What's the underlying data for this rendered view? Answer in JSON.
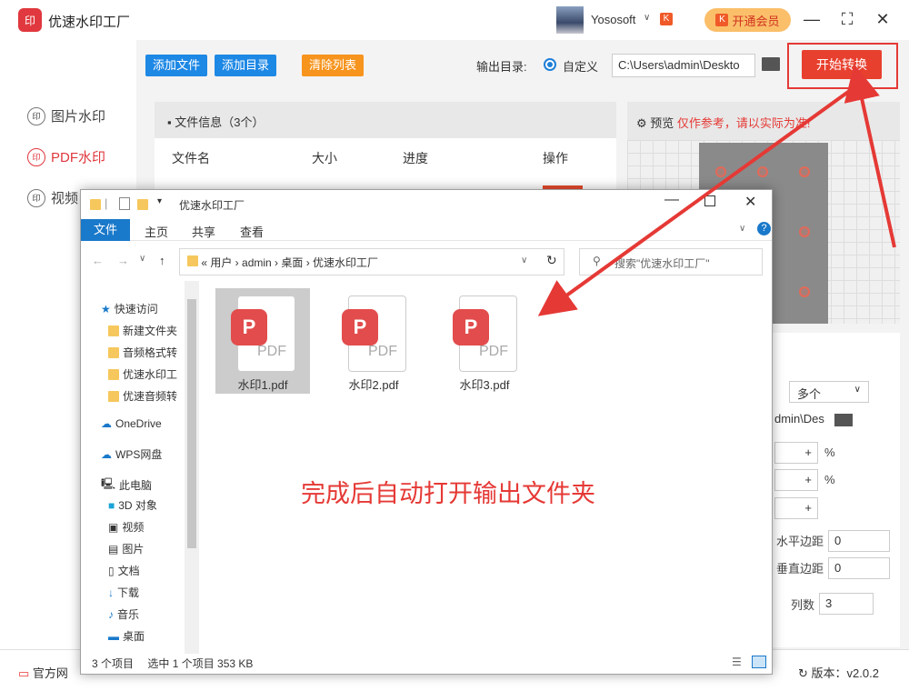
{
  "app": {
    "title": "优速水印工厂",
    "logo_text": "印",
    "username": "Yososoft",
    "vip_label": "开通会员"
  },
  "sidebar": {
    "items": [
      {
        "label": "图片水印",
        "icon": "印"
      },
      {
        "label": "PDF水印",
        "icon": "印"
      },
      {
        "label": "视频",
        "icon": "印"
      }
    ]
  },
  "toolbar": {
    "add_file": "添加文件",
    "add_dir": "添加目录",
    "clear_list": "清除列表",
    "output_label": "输出目录:",
    "custom": "自定义",
    "path": "C:\\Users\\admin\\Deskto",
    "start": "开始转换"
  },
  "filepanel": {
    "info": "文件信息（3个）",
    "cols": [
      "文件名",
      "大小",
      "进度",
      "操作"
    ]
  },
  "preview": {
    "label": "预览",
    "warning": "仅作参考，请以实际为准!"
  },
  "settings": {
    "count_value": "多个",
    "path_tail": "dmin\\Des",
    "pct1": "%",
    "pct2": "%",
    "hmargin_label": "水平边距",
    "hmargin_value": "0",
    "vmargin_label": "垂直边距",
    "vmargin_value": "0",
    "cols_label": "列数",
    "cols_value": "3"
  },
  "bottom": {
    "official": "官方网",
    "version": "版本：v2.0.2"
  },
  "explorer": {
    "title": "优速水印工厂",
    "tabs": [
      "文件",
      "主页",
      "共享",
      "查看"
    ],
    "breadcrumb": "« 用户 › admin › 桌面 › 优速水印工厂",
    "search_placeholder": "搜索\"优速水印工厂\"",
    "nav": [
      "快速访问",
      "新建文件夹",
      "音频格式转",
      "优速水印工",
      "优速音频转",
      "OneDrive",
      "WPS网盘",
      "此电脑",
      "3D 对象",
      "视频",
      "图片",
      "文档",
      "下载",
      "音乐",
      "桌面"
    ],
    "files": [
      {
        "name": "水印1.pdf"
      },
      {
        "name": "水印2.pdf"
      },
      {
        "name": "水印3.pdf"
      }
    ],
    "status_count": "3 个项目",
    "status_sel": "选中 1 个项目  353 KB"
  },
  "annotation": {
    "message": "完成后自动打开输出文件夹"
  },
  "colors": {
    "accent": "#e53935",
    "blue": "#1e7fd8",
    "orange": "#f7941d"
  }
}
